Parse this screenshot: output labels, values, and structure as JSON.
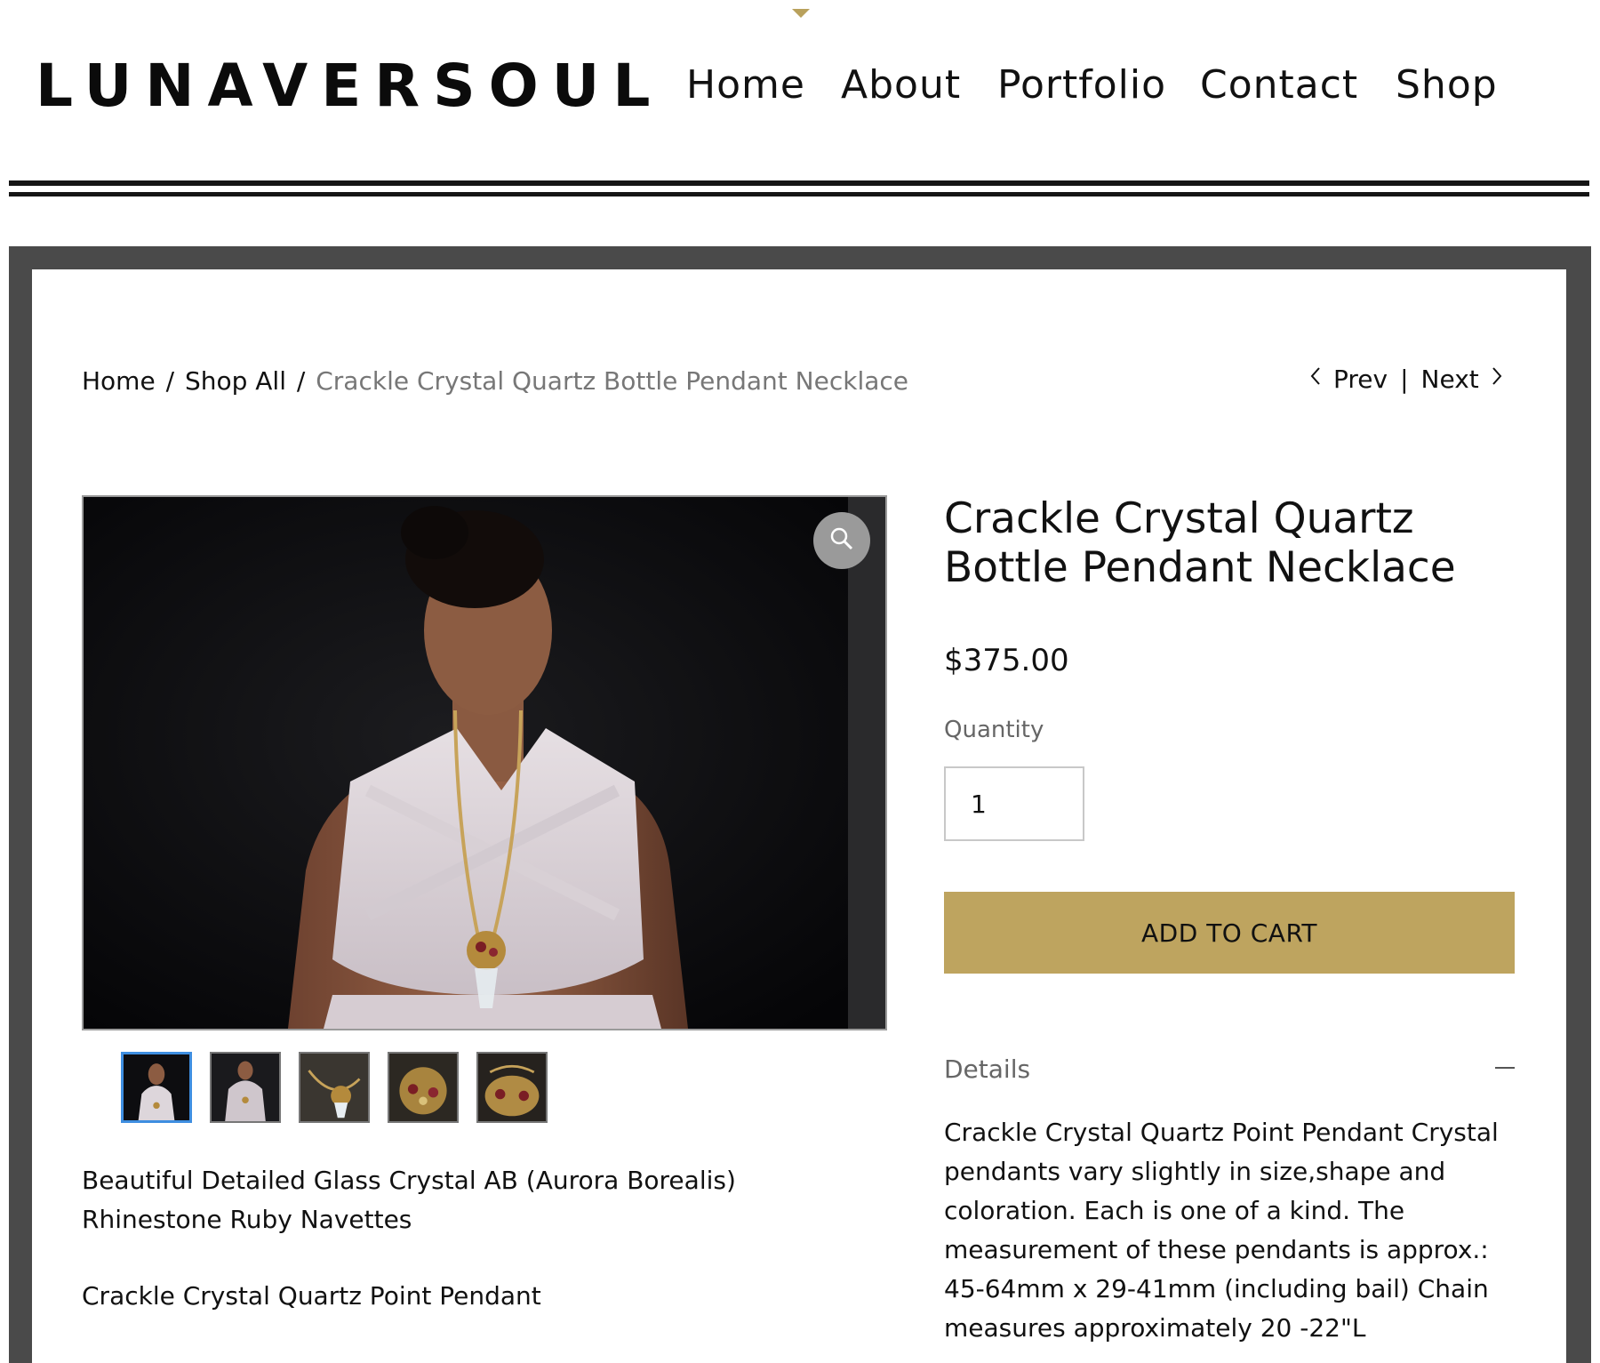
{
  "site": {
    "logo": "LUNAVERSOUL",
    "nav": [
      "Home",
      "About",
      "Portfolio",
      "Contact",
      "Shop"
    ]
  },
  "breadcrumb": {
    "home": "Home",
    "shop_all": "Shop All",
    "separator": "/",
    "current": "Crackle Crystal Quartz Bottle Pendant Necklace"
  },
  "pager": {
    "prev": "Prev",
    "next": "Next",
    "divider": "|"
  },
  "gallery": {
    "zoom_icon": "magnifier-icon",
    "thumbnail_count": 5,
    "active_thumbnail": 1
  },
  "description": {
    "line1": "Beautiful Detailed Glass Crystal AB (Aurora Borealis) Rhinestone Ruby Navettes",
    "line2": "Crackle Crystal Quartz Point Pendant"
  },
  "product": {
    "title": "Crackle Crystal Quartz Bottle Pendant Necklace",
    "price": "$375.00",
    "quantity_label": "Quantity",
    "quantity": "1",
    "add_to_cart": "ADD TO CART",
    "details_label": "Details",
    "details_text": "Crackle Crystal Quartz Point Pendant Crystal pendants vary slightly in size,shape and coloration. Each is one of a kind. The measurement of these pendants is approx.: 45-64mm x 29-41mm (including bail) Chain measures approximately 20 -22\"L"
  },
  "colors": {
    "accent": "#bea45f",
    "frame": "#4a4a4a",
    "active_thumb_border": "#3e8ee0"
  }
}
